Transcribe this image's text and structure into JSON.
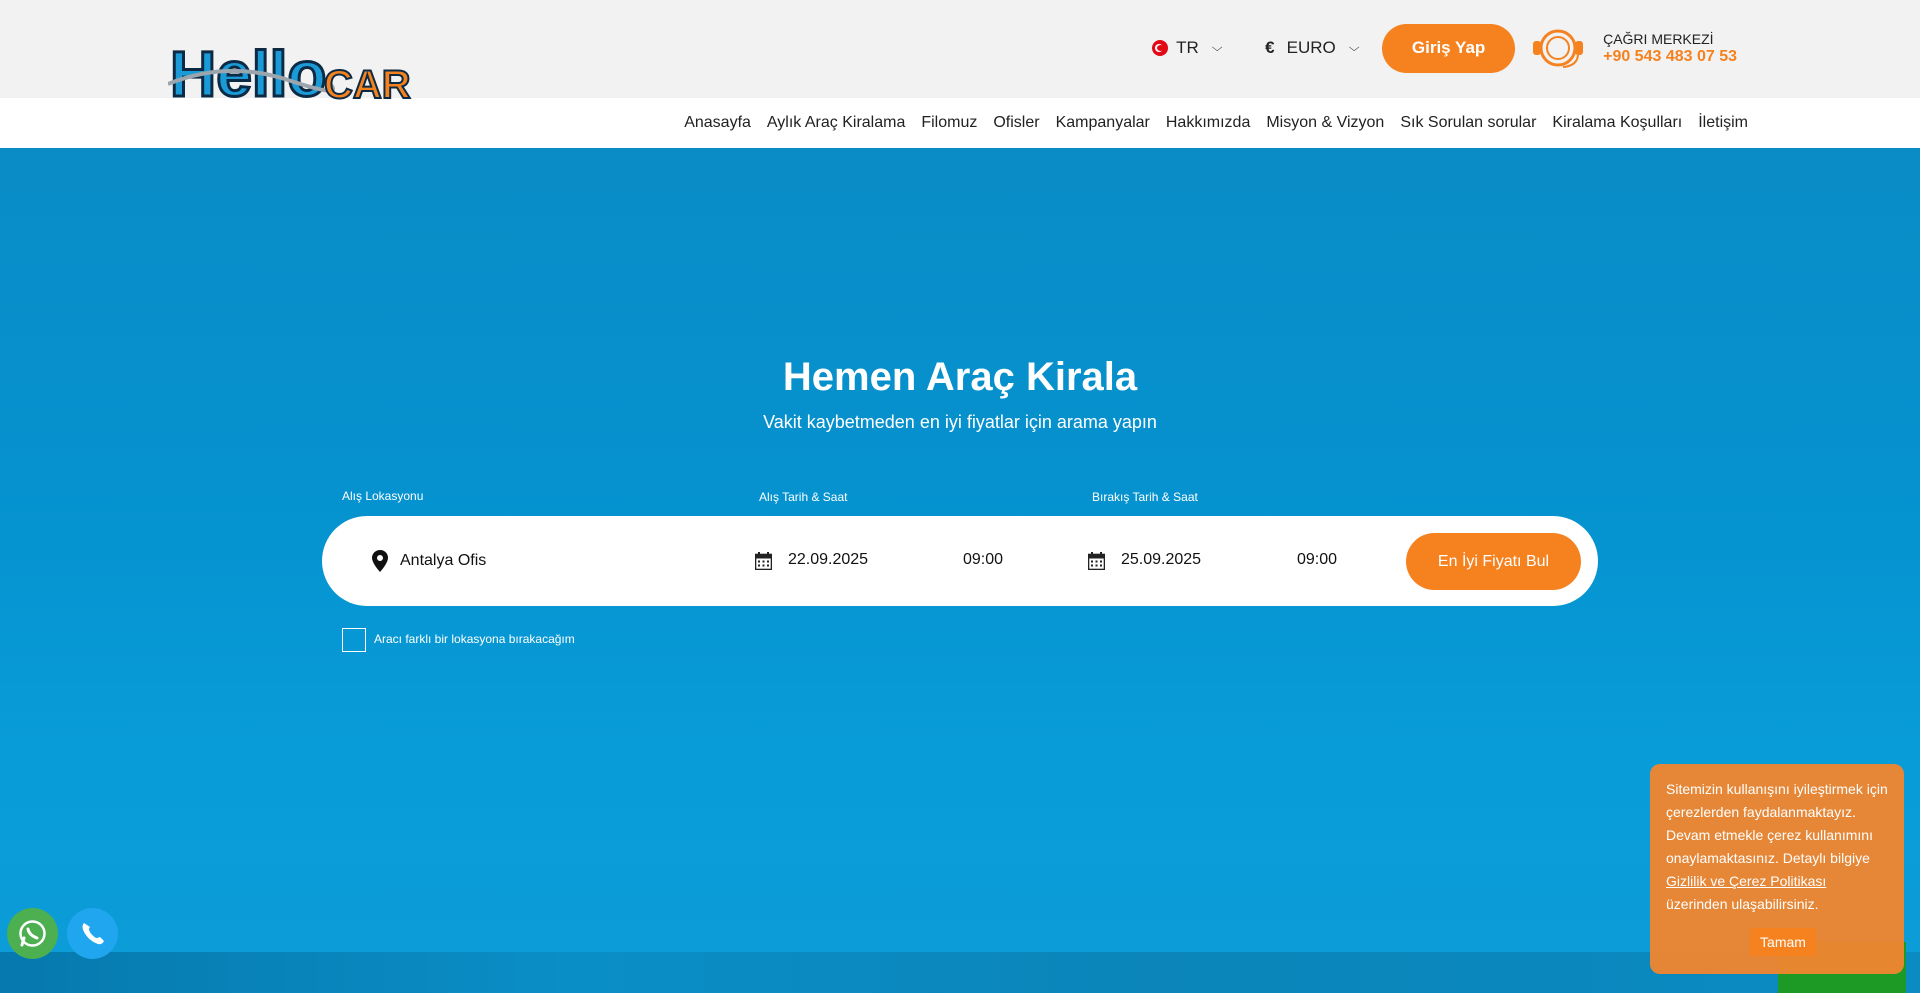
{
  "brand": {
    "logo_text_hello": "Hello",
    "logo_text_car": "CAR",
    "primary_color": "#f5821f",
    "hero_color": "#0592cf"
  },
  "header": {
    "language": "TR",
    "currency_symbol": "€",
    "currency": "EURO",
    "login_label": "Giriş Yap",
    "call_center_label": "ÇAĞRI MERKEZİ",
    "call_center_phone": "+90 543 483 07 53"
  },
  "nav": {
    "items": [
      {
        "label": "Anasayfa"
      },
      {
        "label": "Aylık Araç Kiralama"
      },
      {
        "label": "Filomuz"
      },
      {
        "label": "Ofisler"
      },
      {
        "label": "Kampanyalar"
      },
      {
        "label": "Hakkımızda"
      },
      {
        "label": "Misyon & Vizyon"
      },
      {
        "label": "Sık Sorulan sorular"
      },
      {
        "label": "Kiralama Koşulları"
      },
      {
        "label": "İletişim"
      }
    ]
  },
  "hero": {
    "title": "Hemen Araç Kirala",
    "subtitle": "Vakit kaybetmeden en iyi fiyatlar için arama yapın"
  },
  "search": {
    "pickup_location_label": "Alış Lokasyonu",
    "pickup_location_value": "Antalya Ofis",
    "pickup_datetime_label": "Alış Tarih & Saat",
    "pickup_date": "22.09.2025",
    "pickup_time": "09:00",
    "dropoff_datetime_label": "Bırakış Tarih & Saat",
    "dropoff_date": "25.09.2025",
    "dropoff_time": "09:00",
    "submit_label": "En İyi Fiyatı Bul",
    "different_location_label": "Aracı farklı bir lokasyona bırakacağım"
  },
  "cookie": {
    "text_before": "Sitemizin kullanışını iyileştirmek için çerezlerden faydalanmaktayız. Devam etmekle çerez kullanımını onaylamaktasınız. Detaylı bilgiye",
    "link_text": "Gizlilik ve Çerez Politikası",
    "text_after": "üzerinden ulaşabilirsiniz.",
    "ok_label": "Tamam"
  },
  "icons": {
    "whatsapp": "whatsapp-icon",
    "phone": "phone-icon",
    "map_pin": "map-pin-icon",
    "calendar": "calendar-icon",
    "headset": "headset-icon"
  }
}
